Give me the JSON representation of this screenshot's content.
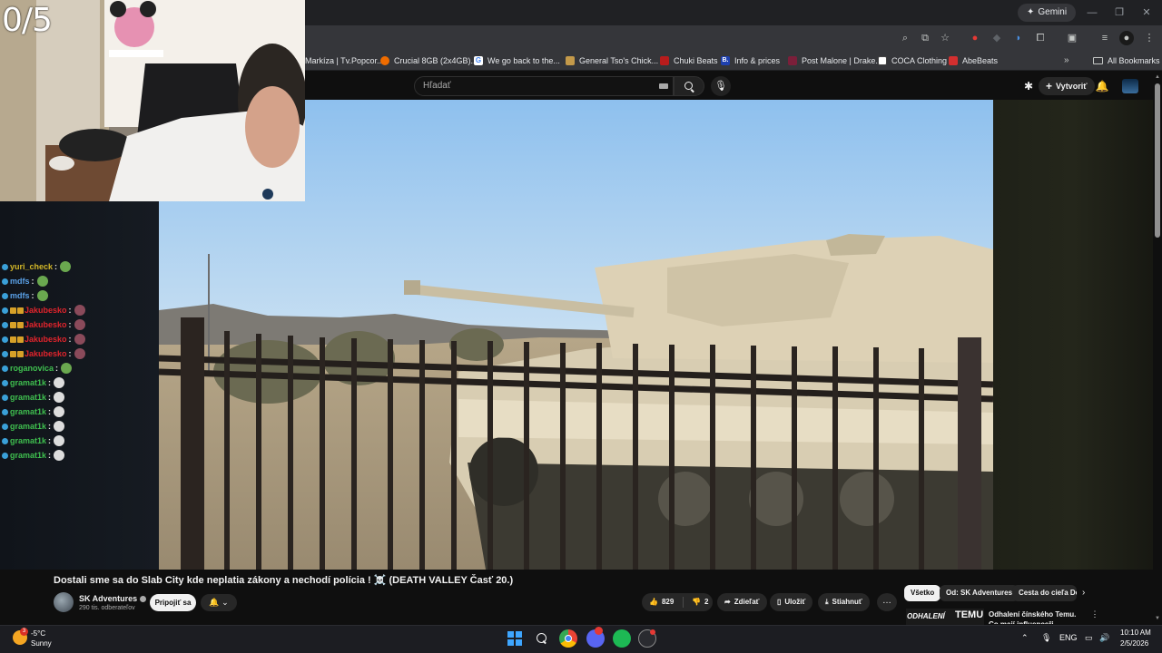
{
  "browser": {
    "gemini_label": "Gemini",
    "bookmarks": [
      {
        "label": "Markíza | Tv.Popcor...",
        "color": "#e53935"
      },
      {
        "label": "Crucial 8GB (2x4GB)...",
        "color": "#ef6c00"
      },
      {
        "label": "We go back to the...",
        "color": "#4285f4"
      },
      {
        "label": "General Tso's Chick...",
        "color": "#c49a4a"
      },
      {
        "label": "Chuki Beats",
        "color": "#b71c1c"
      },
      {
        "label": "Info & prices",
        "color": "#1e40af"
      },
      {
        "label": "Post Malone | Drake...",
        "color": "#7b1f3a"
      },
      {
        "label": "COCA Clothing",
        "color": "#444444"
      },
      {
        "label": "AbeBeats",
        "color": "#d32f2f"
      }
    ],
    "all_bookmarks_label": "All Bookmarks"
  },
  "youtube": {
    "search_placeholder": "Hľadať",
    "create_label": "Vytvoriť",
    "video_title": "Dostali sme sa do Slab City kde neplatia zákony a nechodí polícia ! ☠️ (DEATH VALLEY Časť 20.)",
    "channel_name": "SK Adventures",
    "subscribers": "290 tis. odberateľov",
    "join_label": "Pripojiť sa",
    "like_count": "829",
    "dislike_count": "2",
    "share_label": "Zdieľať",
    "save_label": "Uložiť",
    "download_label": "Stiahnuť",
    "chips": [
      "Všetko",
      "Od: SK Adventures",
      "Cesta do cieľa Do"
    ],
    "rec_thumb_text_1": "ODHALENÍ",
    "rec_thumb_text_2": "TEMU",
    "rec_title": "Odhalení čínského Temu. Co mají influenceři nechcou?"
  },
  "stream": {
    "counter": "0/5",
    "chat": [
      {
        "user": "yuri_check",
        "color": "#d4b828",
        "subs": 0
      },
      {
        "user": "mdfs",
        "color": "#5aa0e6",
        "subs": 0
      },
      {
        "user": "mdfs",
        "color": "#5aa0e6",
        "subs": 0
      },
      {
        "user": "Jakubesko",
        "color": "#e0242c",
        "subs": 2
      },
      {
        "user": "Jakubesko",
        "color": "#e0242c",
        "subs": 2
      },
      {
        "user": "Jakubesko",
        "color": "#e0242c",
        "subs": 2
      },
      {
        "user": "Jakubesko",
        "color": "#e0242c",
        "subs": 2
      },
      {
        "user": "roganovica",
        "color": "#3fbf4f",
        "subs": 0
      },
      {
        "user": "gramat1k",
        "color": "#3fbf4f",
        "subs": 0
      },
      {
        "user": "gramat1k",
        "color": "#3fbf4f",
        "subs": 0
      },
      {
        "user": "gramat1k",
        "color": "#3fbf4f",
        "subs": 0
      },
      {
        "user": "gramat1k",
        "color": "#3fbf4f",
        "subs": 0
      },
      {
        "user": "gramat1k",
        "color": "#3fbf4f",
        "subs": 0
      },
      {
        "user": "gramat1k",
        "color": "#3fbf4f",
        "subs": 0
      }
    ]
  },
  "taskbar": {
    "temperature": "-5°C",
    "condition": "Sunny",
    "weather_badge": "3",
    "language": "ENG",
    "time": "10:10 AM",
    "date": "2/5/2026"
  }
}
